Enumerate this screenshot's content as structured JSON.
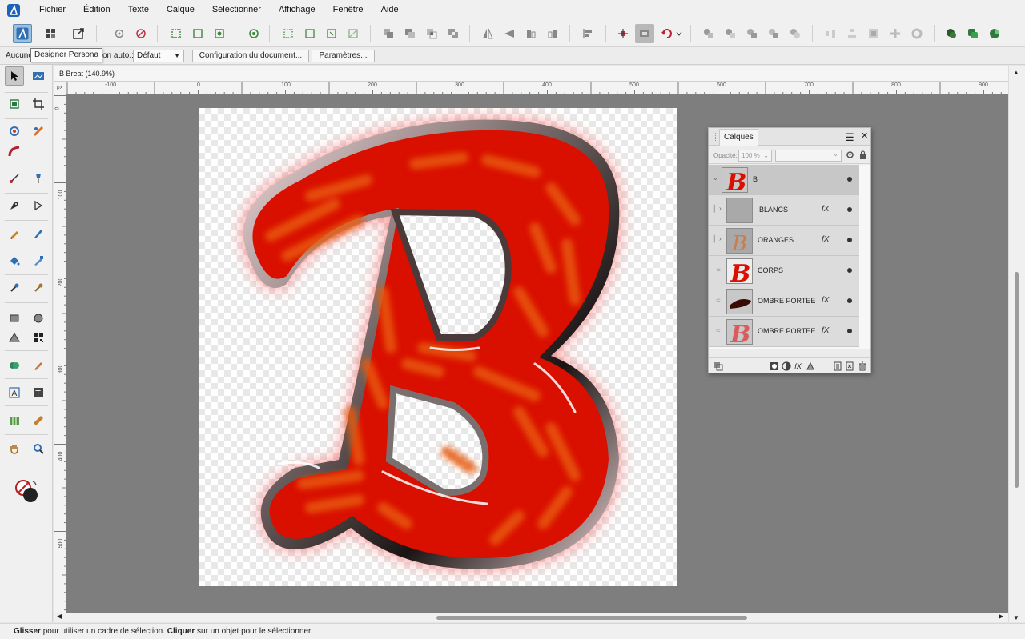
{
  "menubar": {
    "items": [
      "Fichier",
      "Édition",
      "Texte",
      "Calque",
      "Sélectionner",
      "Affichage",
      "Fenêtre",
      "Aide"
    ]
  },
  "tooltip": "Designer Persona",
  "contextbar": {
    "selection_text": "Aucune",
    "auto_label": "ction auto.:",
    "auto_value": "Défaut",
    "doc_setup": "Configuration du document...",
    "params": "Paramètres..."
  },
  "document": {
    "title": "B Breat (140.9%)",
    "close": "×"
  },
  "ruler": {
    "unit": "px",
    "top_labels": [
      "-100",
      "0",
      "100",
      "200",
      "300",
      "400",
      "500",
      "600",
      "700",
      "800",
      "900"
    ],
    "left_labels": [
      "0",
      "100",
      "200",
      "300",
      "400",
      "500"
    ]
  },
  "layers_panel": {
    "tab": "Calques",
    "opacity_label": "Opacité:",
    "opacity_value": "100 %",
    "layers": [
      {
        "name": "B",
        "fx": false,
        "group": true
      },
      {
        "name": "BLANCS",
        "fx": true,
        "group": true
      },
      {
        "name": "ORANGES",
        "fx": true,
        "group": true
      },
      {
        "name": "CORPS",
        "fx": false,
        "group": false
      },
      {
        "name": "OMBRE PORTEE",
        "fx": true,
        "group": false
      },
      {
        "name": "OMBRE PORTEE",
        "fx": true,
        "group": false
      }
    ],
    "fx_symbol": "fX"
  },
  "status": {
    "bold1": "Glisser",
    "text1": " pour utiliser un cadre de sélection. ",
    "bold2": "Cliquer",
    "text2": " sur un objet pour le sélectionner."
  },
  "colors": {
    "letter_red": "#d90f00",
    "letter_orange": "#e85a0c",
    "accent_blue": "#2f6fb5",
    "canvas_grey": "#7e7e7e"
  }
}
